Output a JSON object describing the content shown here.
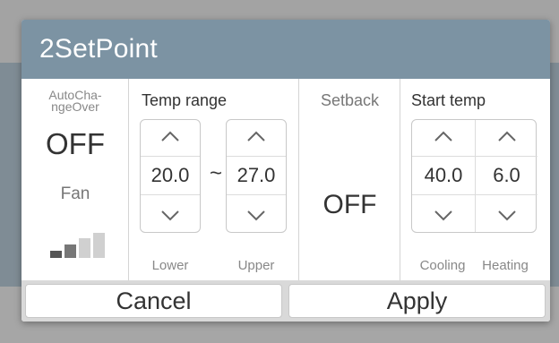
{
  "dialog": {
    "title": "2SetPoint"
  },
  "autochangeover": {
    "label": "AutoCha-\nngeOver",
    "value": "OFF",
    "fan_label": "Fan",
    "fan_level_icon": "fan-level-bars-icon"
  },
  "temp_range": {
    "title": "Temp range",
    "lower": {
      "value": "20.0",
      "label": "Lower"
    },
    "separator": "~",
    "upper": {
      "value": "27.0",
      "label": "Upper"
    }
  },
  "setback": {
    "title": "Setback",
    "value": "OFF"
  },
  "start_temp": {
    "title": "Start temp",
    "cooling": {
      "value": "40.0",
      "label": "Cooling"
    },
    "heating": {
      "value": "6.0",
      "label": "Heating"
    }
  },
  "buttons": {
    "cancel": "Cancel",
    "apply": "Apply"
  },
  "colors": {
    "titlebar": "#7c93a3",
    "overlay": "#8c8c8c"
  }
}
